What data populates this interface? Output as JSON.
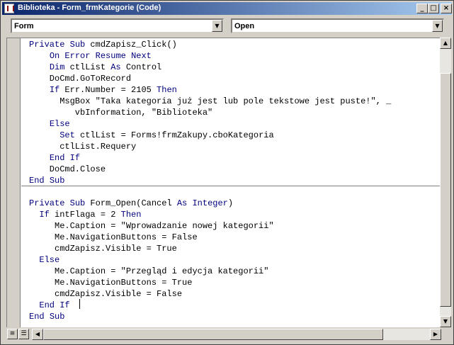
{
  "window": {
    "title": "Biblioteka - Form_frmKategorie (Code)",
    "buttons": {
      "minimize": "_",
      "maximize": "□",
      "close": "×"
    }
  },
  "toolbar": {
    "object_combo": "Form",
    "procedure_combo": "Open",
    "dropdown_glyph": "▼"
  },
  "code": {
    "lines": [
      "Private Sub cmdZapisz_Click()",
      "    On Error Resume Next",
      "    Dim ctlList As Control",
      "    DoCmd.GoToRecord",
      "    If Err.Number = 2105 Then",
      "      MsgBox \"Taka kategoria już jest lub pole tekstowe jest puste!\", _",
      "         vbInformation, \"Biblioteka\"",
      "    Else",
      "      Set ctlList = Forms!frmZakupy.cboKategoria",
      "      ctlList.Requery",
      "    End If",
      "    DoCmd.Close",
      "End Sub",
      "",
      "Private Sub Form_Open(Cancel As Integer)",
      "  If intFlaga = 2 Then",
      "     Me.Caption = \"Wprowadzanie nowej kategorii\"",
      "     Me.NavigationButtons = False",
      "     cmdZapisz.Visible = True",
      "  Else",
      "     Me.Caption = \"Przegląd i edycja kategorii\"",
      "     Me.NavigationButtons = True",
      "     cmdZapisz.Visible = False",
      "  End If",
      "End Sub"
    ],
    "keyword_color": "#00007f"
  },
  "scrollbars": {
    "up": "▲",
    "down": "▼",
    "left": "◀",
    "right": "▶"
  },
  "view_buttons": {
    "procedure_view": "≡",
    "full_module_view": "☰"
  }
}
